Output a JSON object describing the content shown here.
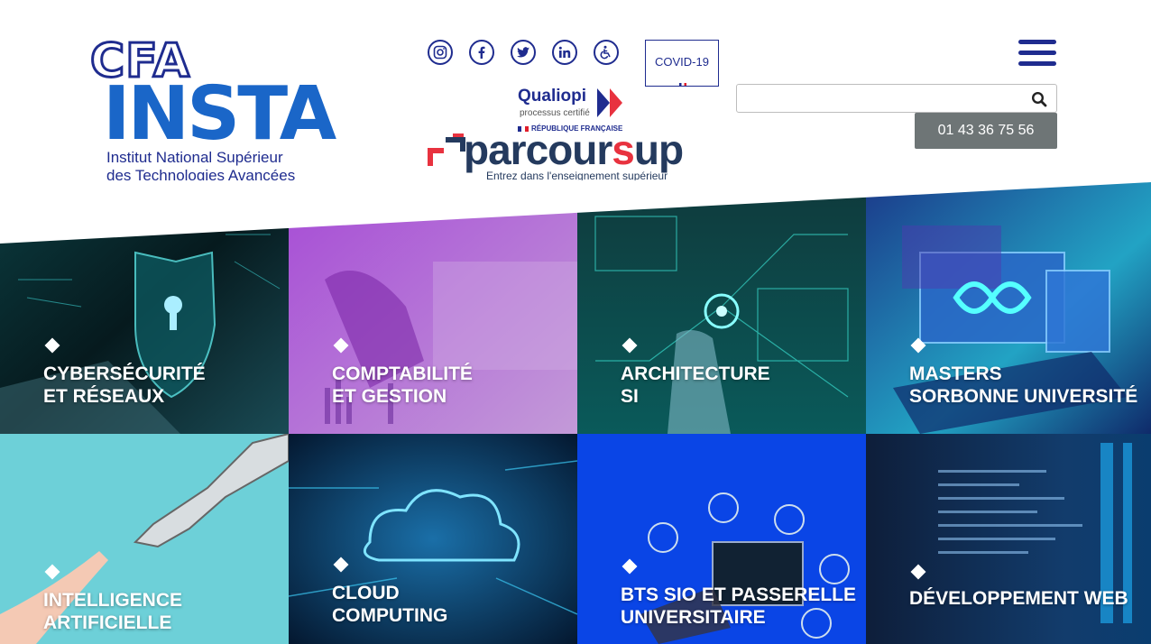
{
  "logo": {
    "cfa": "CFA",
    "insta": "INSTA",
    "line1": "Institut National Supérieur",
    "line2": "des Technologies Avancées"
  },
  "socials": [
    {
      "icon": "instagram-icon"
    },
    {
      "icon": "facebook-icon"
    },
    {
      "icon": "twitter-icon"
    },
    {
      "icon": "linkedin-icon"
    },
    {
      "icon": "accessibility-icon"
    }
  ],
  "covid_label": "COVID-19",
  "qualiopi": {
    "name": "Qualiopi",
    "sub": "processus certifié"
  },
  "parcoursup": {
    "rf": "RÉPUBLIQUE FRANÇAISE",
    "word_a": "parcour",
    "word_b": "s",
    "word_c": "up",
    "tagline": "Entrez dans l'enseignement supérieur"
  },
  "search": {
    "placeholder": "",
    "value": ""
  },
  "phone": "01 43 36 75 56",
  "colors": {
    "navy": "#1f2c8f",
    "brand_blue": "#1a66c8",
    "phone_bg": "#6e7576",
    "parcoursup_red": "#e8323f"
  },
  "tiles": [
    {
      "line1": "CYBERSÉCURITÉ",
      "line2": "ET RÉSEAUX"
    },
    {
      "line1": "COMPTABILITÉ",
      "line2": "ET GESTION"
    },
    {
      "line1": "ARCHITECTURE",
      "line2": "SI"
    },
    {
      "line1": "MASTERS",
      "line2": "SORBONNE UNIVERSITÉ"
    },
    {
      "line1": "INTELLIGENCE",
      "line2": "ARTIFICIELLE"
    },
    {
      "line1": "CLOUD",
      "line2": "COMPUTING"
    },
    {
      "line1": "BTS SIO ET PASSERELLE",
      "line2": "UNIVERSITAIRE"
    },
    {
      "line1": "DÉVELOPPEMENT WEB",
      "line2": ""
    }
  ]
}
